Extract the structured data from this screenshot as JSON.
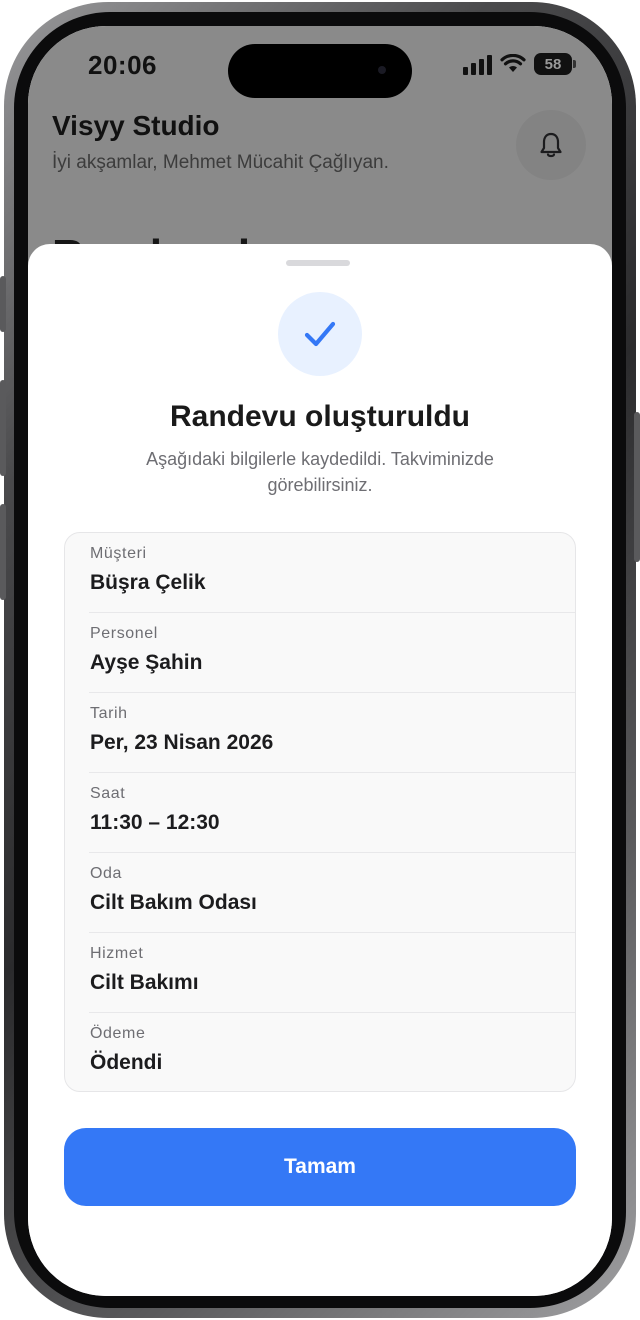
{
  "status_bar": {
    "time": "20:06",
    "battery": "58"
  },
  "background_app": {
    "title": "Visyy Studio",
    "subtitle": "İyi akşamlar, Mehmet Mücahit Çağlıyan.",
    "partial_heading": "Randevular",
    "bell_icon": "bell-icon"
  },
  "sheet": {
    "title": "Randevu oluşturuldu",
    "description": "Aşağıdaki bilgilerle kaydedildi. Takviminizde görebilirsiniz.",
    "success_icon": "checkmark-icon",
    "details": [
      {
        "label": "Müşteri",
        "value": "Büşra Çelik"
      },
      {
        "label": "Personel",
        "value": "Ayşe Şahin"
      },
      {
        "label": "Tarih",
        "value": "Per, 23 Nisan 2026"
      },
      {
        "label": "Saat",
        "value": "11:30 – 12:30"
      },
      {
        "label": "Oda",
        "value": "Cilt Bakım Odası"
      },
      {
        "label": "Hizmet",
        "value": "Cilt Bakımı"
      },
      {
        "label": "Ödeme",
        "value": "Ödendi"
      }
    ],
    "confirm_button": "Tamam"
  },
  "colors": {
    "accent": "#3478f6",
    "success_bg": "#e8f1ff",
    "overlay": "#8a8a8a"
  }
}
